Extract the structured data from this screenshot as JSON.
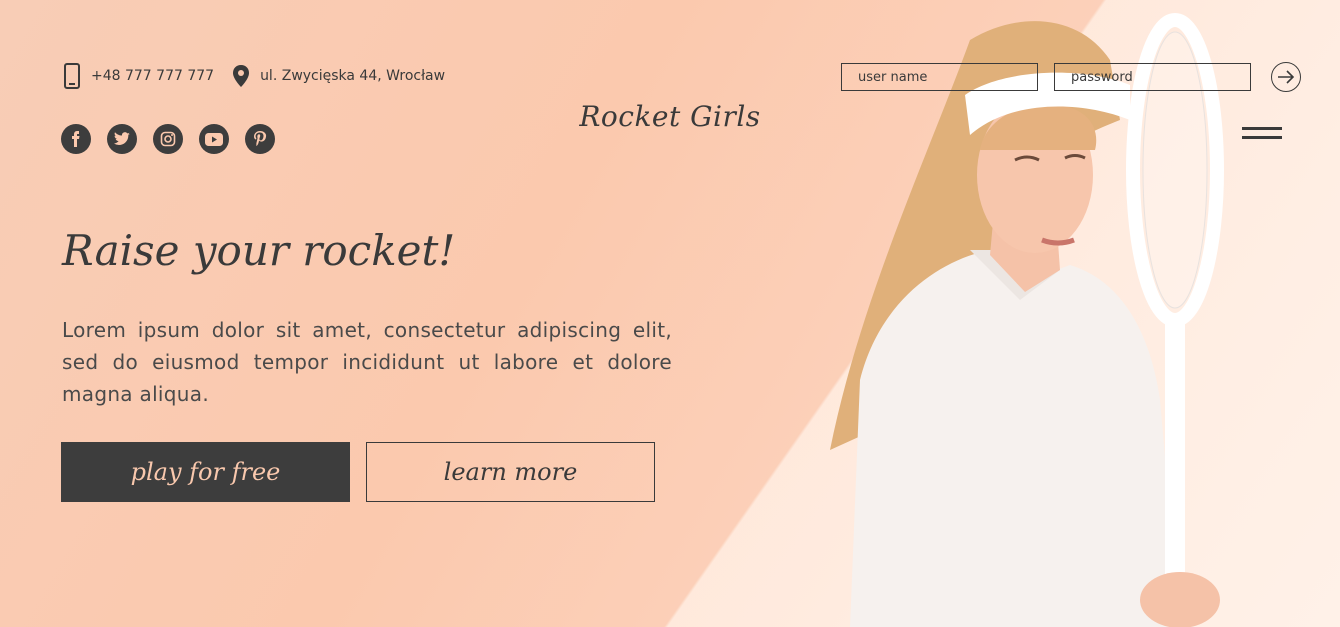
{
  "header": {
    "phone": "+48 777 777 777",
    "address": "ul. Zwycięska 44, Wrocław",
    "logo": "Rocket Girls",
    "login": {
      "username_placeholder": "user name",
      "password_placeholder": "password"
    }
  },
  "social": [
    "facebook-icon",
    "twitter-icon",
    "instagram-icon",
    "youtube-icon",
    "pinterest-icon"
  ],
  "hero": {
    "headline": "Raise your rocket!",
    "text": "Lorem ipsum dolor sit amet, consectetur adipiscing elit, sed do eiusmod tempor incididunt ut labore et dolore magna aliqua.",
    "primary_button": "play for free",
    "secondary_button": "learn more"
  },
  "colors": {
    "accent": "#f9c8ad",
    "dark": "#3d3d3d",
    "background": "#fbc9ae"
  }
}
